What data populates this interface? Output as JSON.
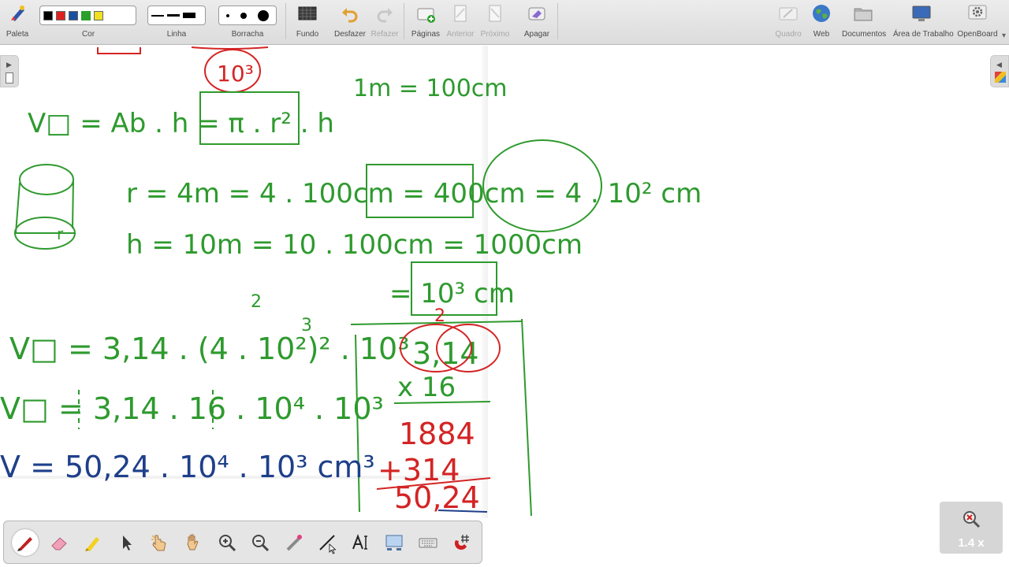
{
  "toolbar": {
    "palette_label": "Paleta",
    "color_label": "Cor",
    "line_label": "Linha",
    "eraser_label": "Borracha",
    "background_label": "Fundo",
    "undo_label": "Desfazer",
    "redo_label": "Refazer",
    "pages_label": "Páginas",
    "previous_label": "Anterior",
    "next_label": "Próximo",
    "clear_label": "Apagar",
    "board_label": "Quadro",
    "web_label": "Web",
    "documents_label": "Documentos",
    "desktop_label": "Área de Trabalho",
    "openboard_label": "OpenBoard"
  },
  "colors": {
    "palette": [
      "#000000",
      "#e02020",
      "#1a4fa0",
      "#2aa02a",
      "#f0e020"
    ],
    "ink_green": "#2e9a2e",
    "ink_red": "#d42424",
    "ink_blue": "#1e3f8a"
  },
  "board": {
    "eq_unit": "1m = 100cm",
    "eq_volume_formula": "V□ = Ab . h = π . r² . h",
    "eq_radius": "r = 4m = 4 . 100cm = 400cm = 4 . 10² cm",
    "eq_height": "h = 10m = 10 . 100cm = 1000cm",
    "eq_height_2": "= 10³ cm",
    "eq_volume_1": "V□ = 3,14 . (4 . 10²)² . 10³",
    "eq_volume_2": "V□ = 3,14 . 16 . 10⁴ . 10³",
    "eq_volume_3": "V = 50,24 . 10⁴ . 10³ cm³",
    "calc_top": "3,14",
    "calc_times": "x 16",
    "calc_partial_1": "1884",
    "calc_partial_2": "+314",
    "calc_result": "50,24",
    "calc_carry": "2",
    "top_fragment": "10³",
    "cyl_label": "r",
    "exp_2": "2",
    "exp_3": "3",
    "exp_4": "4"
  },
  "zoom": {
    "value": "1.4 x"
  }
}
